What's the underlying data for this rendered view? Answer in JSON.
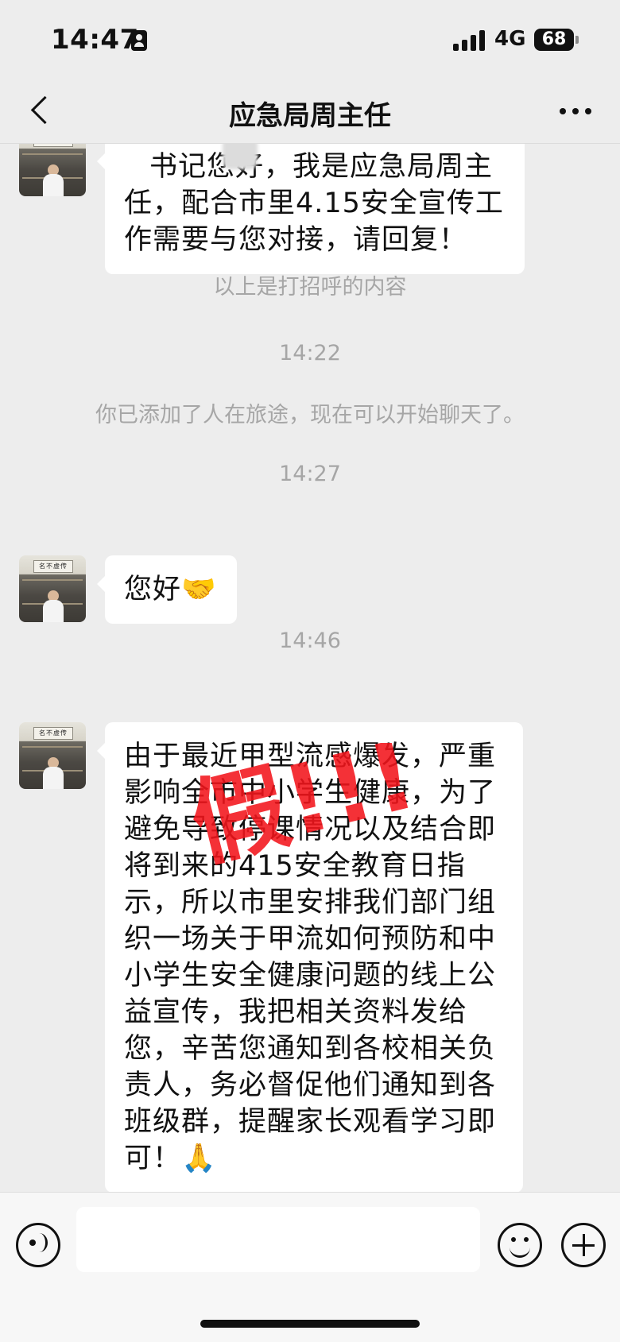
{
  "status_bar": {
    "time": "14:47",
    "network": "4G",
    "battery": "68"
  },
  "nav": {
    "title": "应急局周主任",
    "back_icon": "chevron-left-icon",
    "more_icon": "more-dots-icon"
  },
  "messages": [
    {
      "type": "incoming",
      "text": "书记您好，我是应急局周主任，配合市里4.15安全宣传工作需要与您对接，请回复！"
    },
    {
      "type": "system",
      "text": "以上是打招呼的内容"
    },
    {
      "type": "time",
      "text": "14:22"
    },
    {
      "type": "system",
      "text": "你已添加了人在旅途，现在可以开始聊天了。"
    },
    {
      "type": "time",
      "text": "14:27"
    },
    {
      "type": "incoming",
      "text": "您好🤝"
    },
    {
      "type": "time",
      "text": "14:46"
    },
    {
      "type": "incoming",
      "text": "由于最近甲型流感爆发，严重影响全市中小学生健康，为了避免导致停课情况以及结合即将到来的415安全教育日指示，所以市里安排我们部门组织一场关于甲流如何预防和中小学生安全健康问题的线上公益宣传，我把相关资料发给您，辛苦您通知到各校相关负责人，务必督促他们通知到各班级群，提醒家长观看学习即可！🙏"
    }
  ],
  "overlay": {
    "stamp_text": "假!!!",
    "stamp_color": "#f2141b"
  },
  "avatar": {
    "scroll_text": "名不虚传"
  },
  "input_bar": {
    "text_value": "",
    "voice_icon": "voice-icon",
    "emoji_icon": "emoji-icon",
    "plus_icon": "plus-icon"
  }
}
